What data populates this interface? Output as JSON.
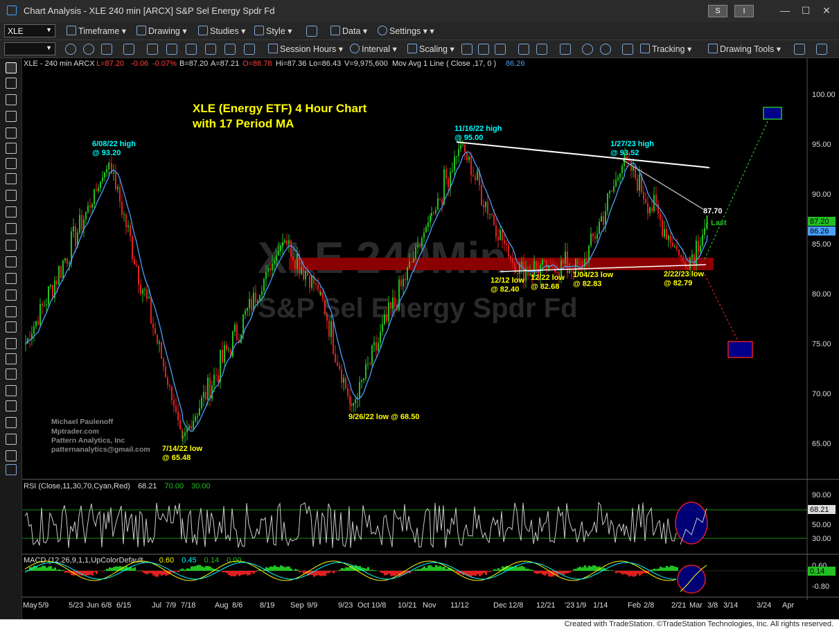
{
  "window": {
    "title": "Chart Analysis - XLE 240 min [ARCX] S&P Sel Energy Spdr Fd",
    "btn_s": "S",
    "btn_i": "I"
  },
  "toolbar1": {
    "symbol": "XLE",
    "timeframe": "Timeframe",
    "drawing": "Drawing",
    "studies": "Studies",
    "style": "Style",
    "data": "Data",
    "settings": "Settings"
  },
  "toolbar2": {
    "session_hours": "Session Hours",
    "interval": "Interval",
    "scaling": "Scaling",
    "tracking": "Tracking",
    "drawing_tools": "Drawing Tools"
  },
  "header": {
    "symbol_info": "XLE - 240 min  ARCX",
    "last": "L=87.20",
    "chg": "-0.06",
    "pct": "-0.07%",
    "bid": "B=87.20",
    "ask": "A=87.21",
    "open": "O=86.78",
    "high": "Hi=87.36",
    "low": "Lo=86.43",
    "volume": "V=9,975,600",
    "ma": "Mov Avg 1 Line ( Close ,17,  0 )",
    "ma_value": "86.26"
  },
  "watermark": {
    "line1": "XLE 240Min",
    "line2": "S&P Sel Energy Spdr Fd"
  },
  "annotations": {
    "title1": "XLE (Energy ETF) 4 Hour Chart",
    "title2": "with 17 Period MA",
    "a1": [
      "6/08/22 high",
      "@ 93.20"
    ],
    "a2": [
      "11/16/22 high",
      "@ 95.00"
    ],
    "a3": [
      "1/27/23 high",
      "@ 93.52"
    ],
    "a4": [
      "7/14/22 low",
      "@ 65.48"
    ],
    "a5": [
      "9/26/22 low @ 68.50"
    ],
    "a6": [
      "12/12 low",
      "@ 82.40"
    ],
    "a7": [
      "12/22 low",
      "@ 82.68"
    ],
    "a8": [
      "1/04/23 low",
      "@ 82.83"
    ],
    "a9": [
      "2/22/23 low",
      "@ 82.79"
    ],
    "level": "87.70",
    "last": "Last",
    "credits": [
      "Michael Paulenoff",
      "Mptrader.com",
      "Pattern Analytics, Inc",
      "patternanalytics@gmail.com"
    ]
  },
  "price_axis": {
    "ticks": [
      "100.00",
      "95.00",
      "90.00",
      "85.00",
      "80.00",
      "75.00",
      "70.00",
      "65.00"
    ],
    "last_badge": "87.20",
    "ma_badge": "86.26"
  },
  "rsi": {
    "label": "RSI (Close,11,30,70,Cyan,Red)",
    "value": "68.21",
    "ob": "70.00",
    "os": "30.00",
    "ticks": [
      "90.00",
      "50.00",
      "30.00"
    ],
    "badge": "68.21"
  },
  "macd": {
    "label": "MACD (12,26,9,1,1,UpColorDefault,...",
    "v1": "0.60",
    "v2": "0.45",
    "v3": "0.14",
    "v4": "0.00",
    "ticks": [
      "0.60",
      "-0.80"
    ],
    "badge": "0.14"
  },
  "time_axis": [
    "May",
    "5/9",
    "5/23",
    "Jun",
    "6/8",
    "6/15",
    "Jul",
    "7/9",
    "7/18",
    "Aug",
    "8/6",
    "8/19",
    "Sep",
    "9/9",
    "9/23",
    "Oct",
    "10/8",
    "10/21",
    "Nov",
    "11/12",
    "Dec",
    "12/8",
    "12/21",
    "'23",
    "1/9",
    "1/14",
    "Feb",
    "2/8",
    "2/21",
    "Mar",
    "3/8",
    "3/14",
    "3/24",
    "Apr"
  ],
  "status": "Created with TradeStation. ©TradeStation Technologies, Inc. All rights reserved.",
  "chart_data": {
    "type": "line",
    "title": "XLE (Energy ETF) 4 Hour Chart with 17 Period MA",
    "x": [
      "5/9/22",
      "6/8/22",
      "7/14/22",
      "8/19/22",
      "9/9/22",
      "9/26/22",
      "10/21/22",
      "11/16/22",
      "12/12/22",
      "12/22/22",
      "1/04/23",
      "1/27/23",
      "2/22/23",
      "3/8/23"
    ],
    "series": [
      {
        "name": "XLE",
        "values": [
          75.0,
          93.2,
          65.48,
          85.5,
          80.0,
          68.5,
          88.0,
          95.0,
          82.4,
          82.68,
          82.83,
          93.52,
          82.79,
          87.2
        ]
      }
    ],
    "ylim": [
      62,
      102
    ],
    "grid": false,
    "legend": "none"
  },
  "colors": {
    "up": "#22c022",
    "down": "#e02020",
    "ma": "#4aa0ff",
    "support_band": "#8b0000",
    "annotation_yellow": "#ffff00",
    "annotation_cyan": "#00ffff",
    "target_box": "#00008b"
  }
}
